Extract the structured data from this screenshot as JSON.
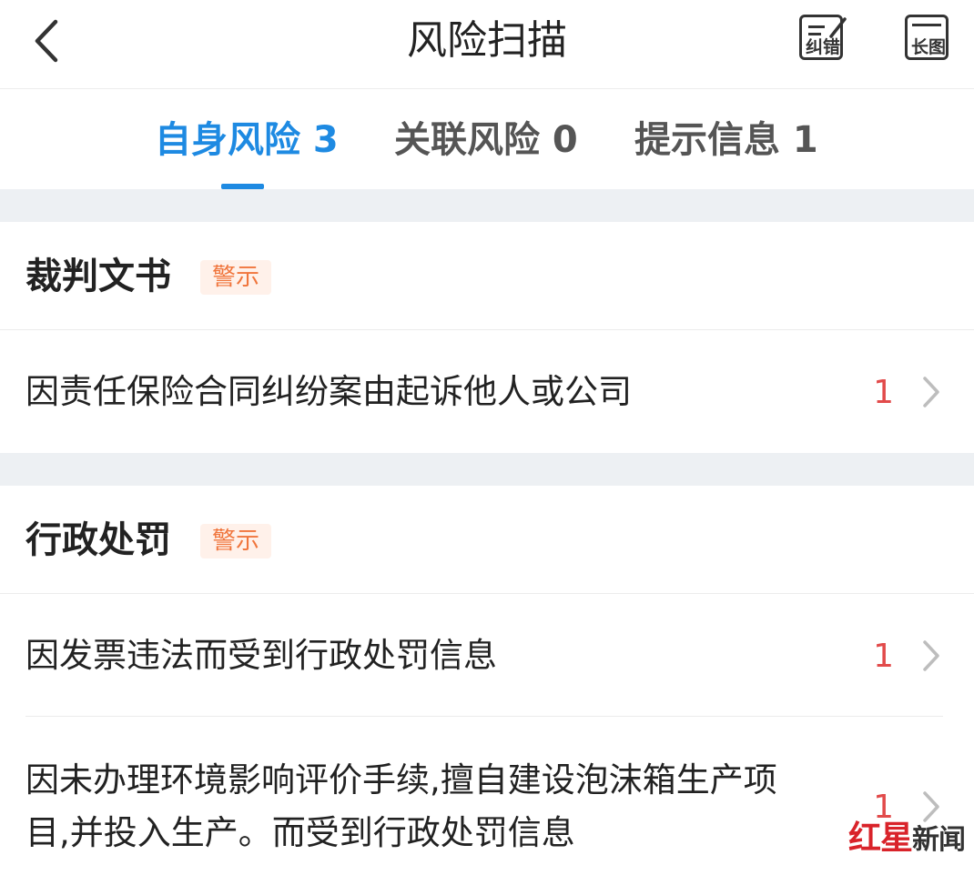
{
  "header": {
    "title": "风险扫描",
    "correct_label": "纠错",
    "long_image_label": "长图"
  },
  "tabs": [
    {
      "label": "自身风险 3",
      "active": true
    },
    {
      "label": "关联风险 0",
      "active": false
    },
    {
      "label": "提示信息 1",
      "active": false
    }
  ],
  "sections": [
    {
      "title": "裁判文书",
      "badge": "警示",
      "items": [
        {
          "text": "因责任保险合同纠纷案由起诉他人或公司",
          "count": "1"
        }
      ]
    },
    {
      "title": "行政处罚",
      "badge": "警示",
      "items": [
        {
          "text": "因发票违法而受到行政处罚信息",
          "count": "1"
        },
        {
          "text_line1": "因未办理环境影响评价手续,擅自建设泡沫箱生产项",
          "text_line2": "目,并投入生产。而受到行政处罚信息",
          "count": "1"
        }
      ]
    }
  ],
  "watermark": {
    "part1": "红星",
    "part2": "新闻"
  },
  "colors": {
    "accent": "#1e8ae2",
    "count": "#e24b4b",
    "badge_text": "#f0753c",
    "badge_bg": "#fff1ea",
    "gap": "#edf0f3"
  }
}
